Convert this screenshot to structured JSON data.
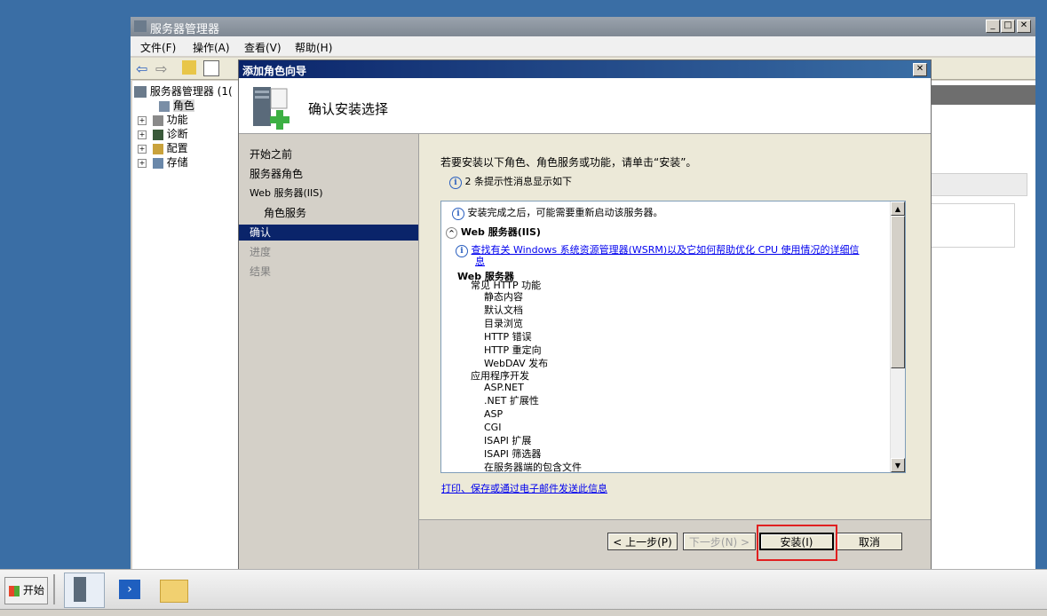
{
  "main_window": {
    "title": "服务器管理器",
    "menu": [
      "文件(F)",
      "操作(A)",
      "查看(V)",
      "帮助(H)"
    ],
    "tree": [
      {
        "label": "服务器管理器  (1(",
        "expand": ""
      },
      {
        "label": "角色",
        "expand": ""
      },
      {
        "label": "功能",
        "expand": "+"
      },
      {
        "label": "诊断",
        "expand": "+"
      },
      {
        "label": "配置",
        "expand": "+"
      },
      {
        "label": "存储",
        "expand": "+"
      }
    ]
  },
  "dialog": {
    "title": "添加角色向导",
    "close_glyph": "✕",
    "header": "确认安装选择",
    "steps": [
      "开始之前",
      "服务器角色",
      "Web 服务器(IIS)",
      "角色服务",
      "确认",
      "进度",
      "结果"
    ],
    "selected_step": "确认",
    "intro": "若要安装以下角色、角色服务或功能，请单击“安装”。",
    "info_count": "2 条提示性消息显示如下",
    "list": {
      "restart_note": "安装完成之后，可能需要重新启动该服务器。",
      "section_title": "Web 服务器(IIS)",
      "wsrm_link_1": "查找有关 Windows 系统资源管理器(WSRM)以及它如何帮助优化 CPU 使用情况的详细信",
      "wsrm_link_2": "息",
      "role_title": "Web 服务器",
      "groups": [
        {
          "name": "常见 HTTP 功能",
          "items": [
            "静态内容",
            "默认文档",
            "目录浏览",
            "HTTP 错误",
            "HTTP 重定向",
            "WebDAV 发布"
          ]
        },
        {
          "name": "应用程序开发",
          "items": [
            "ASP.NET",
            ".NET 扩展性",
            "ASP",
            "CGI",
            "ISAPI 扩展",
            "ISAPI 筛选器",
            "在服务器端的包含文件"
          ]
        }
      ]
    },
    "print_link": "打印、保存或通过电子邮件发送此信息",
    "buttons": {
      "back": "< 上一步(P)",
      "next": "下一步(N) >",
      "install": "安装(I)",
      "cancel": "取消"
    }
  },
  "taskbar": {
    "start": "开始"
  },
  "colors": {
    "desktop": "#3a6ea5",
    "title_active": "#0a246a",
    "highlight_box": "#e02020"
  }
}
